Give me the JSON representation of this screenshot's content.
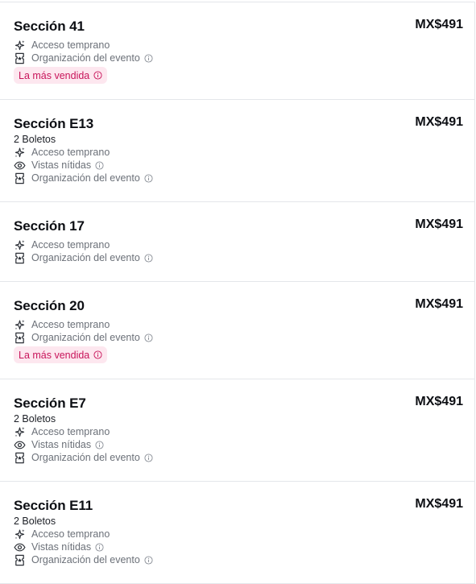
{
  "badge_label": "La más vendida",
  "listings": [
    {
      "section": "Sección 41",
      "price": "MX$491",
      "quantity": "",
      "features": [
        {
          "icon": "sparkle-icon",
          "label": "Acceso temprano",
          "info": false
        },
        {
          "icon": "ticket-icon",
          "label": "Organización del evento",
          "info": true
        }
      ],
      "badge": true
    },
    {
      "section": "Sección E13",
      "price": "MX$491",
      "quantity": "2 Boletos",
      "features": [
        {
          "icon": "sparkle-icon",
          "label": "Acceso temprano",
          "info": false
        },
        {
          "icon": "eye-icon",
          "label": "Vistas nítidas",
          "info": true
        },
        {
          "icon": "ticket-icon",
          "label": "Organización del evento",
          "info": true
        }
      ],
      "badge": false
    },
    {
      "section": "Sección 17",
      "price": "MX$491",
      "quantity": "",
      "features": [
        {
          "icon": "sparkle-icon",
          "label": "Acceso temprano",
          "info": false
        },
        {
          "icon": "ticket-icon",
          "label": "Organización del evento",
          "info": true
        }
      ],
      "badge": false
    },
    {
      "section": "Sección 20",
      "price": "MX$491",
      "quantity": "",
      "features": [
        {
          "icon": "sparkle-icon",
          "label": "Acceso temprano",
          "info": false
        },
        {
          "icon": "ticket-icon",
          "label": "Organización del evento",
          "info": true
        }
      ],
      "badge": true
    },
    {
      "section": "Sección E7",
      "price": "MX$491",
      "quantity": "2 Boletos",
      "features": [
        {
          "icon": "sparkle-icon",
          "label": "Acceso temprano",
          "info": false
        },
        {
          "icon": "eye-icon",
          "label": "Vistas nítidas",
          "info": true
        },
        {
          "icon": "ticket-icon",
          "label": "Organización del evento",
          "info": true
        }
      ],
      "badge": false
    },
    {
      "section": "Sección E11",
      "price": "MX$491",
      "quantity": "2 Boletos",
      "features": [
        {
          "icon": "sparkle-icon",
          "label": "Acceso temprano",
          "info": false
        },
        {
          "icon": "eye-icon",
          "label": "Vistas nítidas",
          "info": true
        },
        {
          "icon": "ticket-icon",
          "label": "Organización del evento",
          "info": true
        }
      ],
      "badge": false
    }
  ]
}
